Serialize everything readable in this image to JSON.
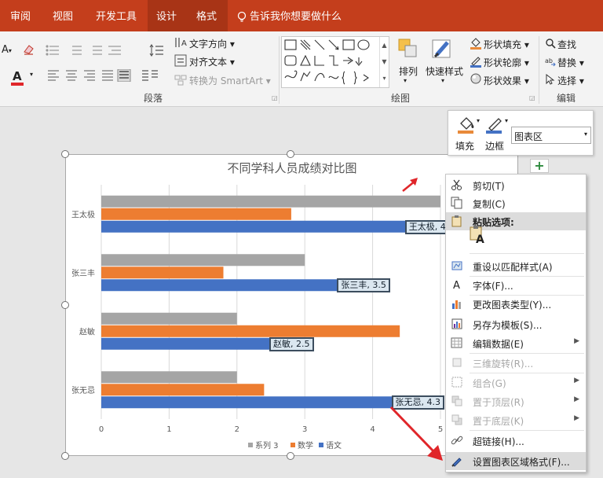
{
  "ribbon_tabs": [
    "审阅",
    "视图",
    "开发工具",
    "设计",
    "格式"
  ],
  "tell_me": "告诉我你想要做什么",
  "paragraph": {
    "text_direction": "文字方向",
    "align_text": "对齐文本",
    "smartart": "转换为 SmartArt",
    "group_label": "段落"
  },
  "drawing": {
    "arrange": "排列",
    "quick_styles": "快速样式",
    "shape_fill": "形状填充",
    "shape_outline": "形状轮廓",
    "shape_effects": "形状效果",
    "group_label": "绘图"
  },
  "editing": {
    "find": "查找",
    "replace": "替换",
    "select": "选择",
    "group_label": "编辑"
  },
  "mini_toolbar": {
    "fill": "填充",
    "border": "边框",
    "element_select": "图表区"
  },
  "chart_data": {
    "type": "bar",
    "title": "不同学科人员成绩对比图",
    "categories": [
      "王太极",
      "张三丰",
      "赵敏",
      "张无忌"
    ],
    "series": [
      {
        "name": "系列 3",
        "color": "#a5a5a5",
        "values": [
          5.0,
          3.0,
          2.0,
          2.0
        ]
      },
      {
        "name": "数学",
        "color": "#ed7d31",
        "values": [
          2.8,
          1.8,
          4.4,
          2.4
        ]
      },
      {
        "name": "语文",
        "color": "#4472c4",
        "values": [
          4.5,
          3.5,
          2.5,
          4.3
        ]
      }
    ],
    "xlim": [
      0,
      5
    ],
    "xticks": [
      "0",
      "1",
      "2",
      "3",
      "4",
      "5"
    ],
    "grid": true,
    "legend": "bottom",
    "data_labels": [
      "王太极, 4.",
      "张三丰, 3.5",
      "赵敏, 2.5",
      "张无忌, 4.3"
    ]
  },
  "context_menu": [
    {
      "label": "剪切(T)",
      "icon": "scissors-icon",
      "enabled": true,
      "submenu": false
    },
    {
      "label": "复制(C)",
      "icon": "copy-icon",
      "enabled": true,
      "submenu": false
    },
    {
      "label": "粘贴选项:",
      "icon": "paste-icon",
      "enabled": true,
      "submenu": false
    },
    {
      "label": "重设以匹配样式(A)",
      "icon": "reset-style-icon",
      "enabled": true,
      "submenu": false
    },
    {
      "label": "字体(F)...",
      "icon": "font-icon",
      "enabled": true,
      "submenu": false
    },
    {
      "label": "更改图表类型(Y)...",
      "icon": "chart-type-icon",
      "enabled": true,
      "submenu": false
    },
    {
      "label": "另存为模板(S)...",
      "icon": "template-icon",
      "enabled": true,
      "submenu": false
    },
    {
      "label": "编辑数据(E)",
      "icon": "edit-data-icon",
      "enabled": true,
      "submenu": true
    },
    {
      "label": "三维旋转(R)...",
      "icon": "rotate-3d-icon",
      "enabled": false,
      "submenu": false
    },
    {
      "label": "组合(G)",
      "icon": "group-icon",
      "enabled": false,
      "submenu": true
    },
    {
      "label": "置于顶层(R)",
      "icon": "bring-front-icon",
      "enabled": false,
      "submenu": true
    },
    {
      "label": "置于底层(K)",
      "icon": "send-back-icon",
      "enabled": false,
      "submenu": true
    },
    {
      "label": "超链接(H)...",
      "icon": "hyperlink-icon",
      "enabled": true,
      "submenu": false
    },
    {
      "label": "设置图表区域格式(F)...",
      "icon": "format-area-icon",
      "enabled": true,
      "submenu": false
    }
  ],
  "colors": {
    "accent": "#c43e1c",
    "gray": "#a5a5a5",
    "orange": "#ed7d31",
    "blue": "#4472c4",
    "arrow": "#e0262a"
  }
}
